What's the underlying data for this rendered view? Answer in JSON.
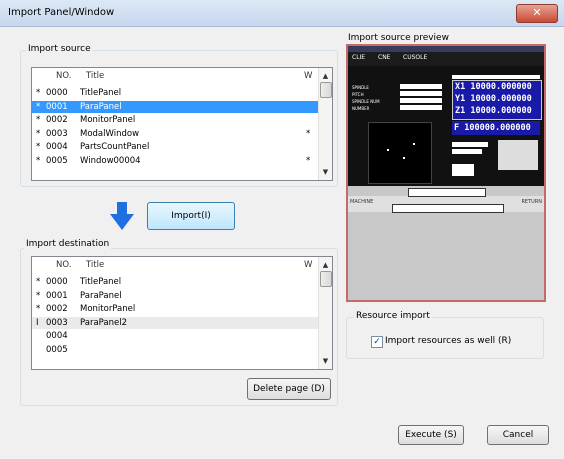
{
  "window": {
    "title": "Import Panel/Window",
    "close_glyph": "✕"
  },
  "import_source": {
    "legend": "Import source",
    "headers": {
      "no": "NO.",
      "title": "Title",
      "w": "W"
    },
    "rows": [
      {
        "marker": "*",
        "no": "0000",
        "title": "TitlePanel",
        "w": ""
      },
      {
        "marker": "*",
        "no": "0001",
        "title": "ParaPanel",
        "w": ""
      },
      {
        "marker": "*",
        "no": "0002",
        "title": "MonitorPanel",
        "w": ""
      },
      {
        "marker": "*",
        "no": "0003",
        "title": "ModalWindow",
        "w": "*"
      },
      {
        "marker": "*",
        "no": "0004",
        "title": "PartsCountPanel",
        "w": ""
      },
      {
        "marker": "*",
        "no": "0005",
        "title": "Window00004",
        "w": "*"
      }
    ],
    "selected_index": 1
  },
  "import_button": {
    "label": "Import(I)"
  },
  "import_destination": {
    "legend": "Import destination",
    "headers": {
      "no": "NO.",
      "title": "Title",
      "w": "W"
    },
    "rows": [
      {
        "marker": "*",
        "no": "0000",
        "title": "TitlePanel",
        "w": ""
      },
      {
        "marker": "*",
        "no": "0001",
        "title": "ParaPanel",
        "w": ""
      },
      {
        "marker": "*",
        "no": "0002",
        "title": "MonitorPanel",
        "w": ""
      },
      {
        "marker": "I",
        "no": "0003",
        "title": "ParaPanel2",
        "w": ""
      },
      {
        "marker": "",
        "no": "0004",
        "title": "",
        "w": ""
      },
      {
        "marker": "",
        "no": "0005",
        "title": "",
        "w": ""
      }
    ],
    "highlight_index": 3
  },
  "delete_button": {
    "label": "Delete page (D)"
  },
  "preview": {
    "label": "Import source preview",
    "tabs": [
      "CLIE",
      "CNE",
      "CUSOLE"
    ],
    "readouts": [
      {
        "axis": "X1",
        "value": "10000.000000"
      },
      {
        "axis": "Y1",
        "value": "10000.000000"
      },
      {
        "axis": "Z1",
        "value": "10000.000000"
      }
    ],
    "feed": {
      "axis": "F",
      "value": "100000.000000"
    },
    "left_labels": [
      "SPINDLE",
      "PITCH",
      "SPINDLE NUM",
      "NUMBER"
    ],
    "bottom_left": "MACHINE",
    "bottom_right": "RETURN"
  },
  "resource_import": {
    "legend": "Resource import",
    "checkbox_label": "Import resources as well (R)",
    "checked": true
  },
  "execute_button": {
    "label": "Execute (S)"
  },
  "cancel_button": {
    "label": "Cancel"
  },
  "colors": {
    "selection": "#3399ff",
    "arrow": "#1f6fe0",
    "preview_border": "#c46a6a"
  }
}
